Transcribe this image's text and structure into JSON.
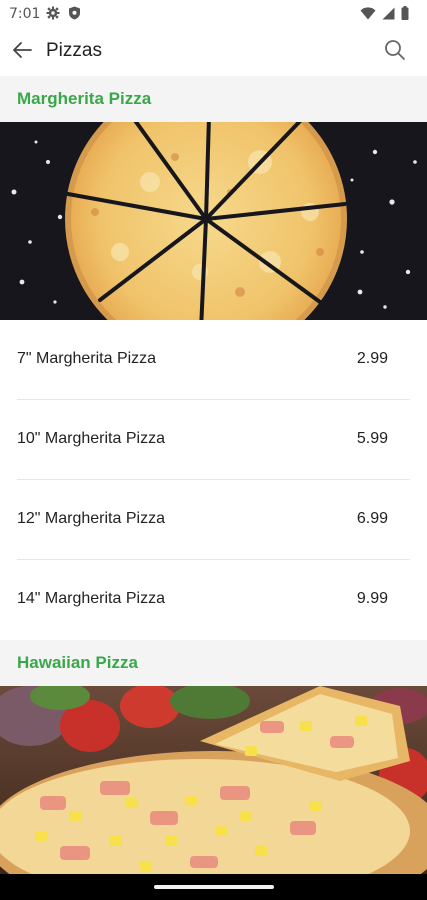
{
  "status_bar": {
    "time": "7:01",
    "icons": [
      "gear-icon",
      "shield-icon",
      "wifi-icon",
      "signal-icon",
      "battery-icon"
    ]
  },
  "toolbar": {
    "title": "Pizzas",
    "back_icon": "arrow-left-icon",
    "search_icon": "search-icon"
  },
  "sections": [
    {
      "title": "Margherita Pizza",
      "image": "margherita-pizza-photo",
      "items": [
        {
          "name": "7\" Margherita Pizza",
          "price": "2.99"
        },
        {
          "name": "10\" Margherita Pizza",
          "price": "5.99"
        },
        {
          "name": "12\" Margherita Pizza",
          "price": "6.99"
        },
        {
          "name": "14\" Margherita Pizza",
          "price": "9.99"
        }
      ]
    },
    {
      "title": "Hawaiian Pizza",
      "image": "hawaiian-pizza-photo",
      "items": []
    }
  ],
  "colors": {
    "accent_green": "#3aa84a",
    "section_background": "#f4f4f4",
    "divider": "#e6e6e6",
    "nav_bar": "#000000"
  }
}
